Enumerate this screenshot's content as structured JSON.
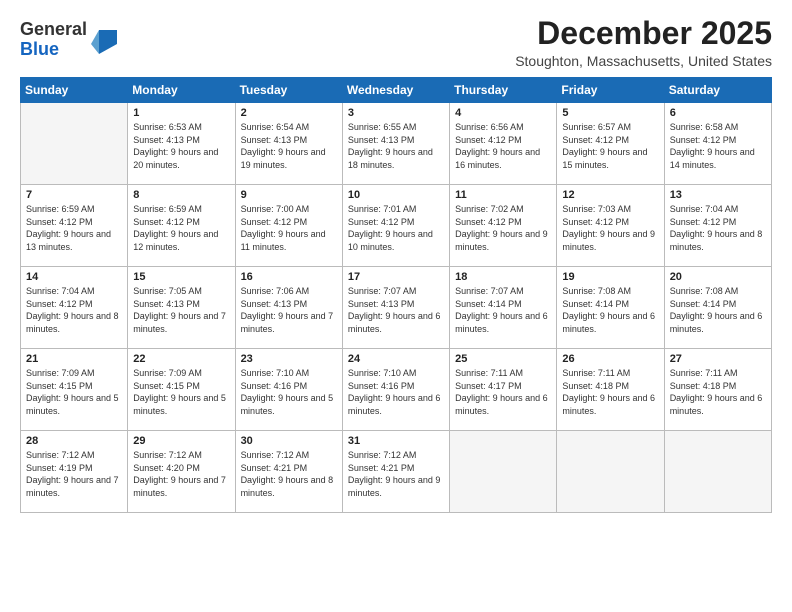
{
  "header": {
    "logo": {
      "general": "General",
      "blue": "Blue"
    },
    "month": "December 2025",
    "location": "Stoughton, Massachusetts, United States"
  },
  "weekdays": [
    "Sunday",
    "Monday",
    "Tuesday",
    "Wednesday",
    "Thursday",
    "Friday",
    "Saturday"
  ],
  "weeks": [
    [
      {
        "day": null,
        "info": null
      },
      {
        "day": "1",
        "sunrise": "6:53 AM",
        "sunset": "4:13 PM",
        "daylight": "9 hours and 20 minutes."
      },
      {
        "day": "2",
        "sunrise": "6:54 AM",
        "sunset": "4:13 PM",
        "daylight": "9 hours and 19 minutes."
      },
      {
        "day": "3",
        "sunrise": "6:55 AM",
        "sunset": "4:13 PM",
        "daylight": "9 hours and 18 minutes."
      },
      {
        "day": "4",
        "sunrise": "6:56 AM",
        "sunset": "4:12 PM",
        "daylight": "9 hours and 16 minutes."
      },
      {
        "day": "5",
        "sunrise": "6:57 AM",
        "sunset": "4:12 PM",
        "daylight": "9 hours and 15 minutes."
      },
      {
        "day": "6",
        "sunrise": "6:58 AM",
        "sunset": "4:12 PM",
        "daylight": "9 hours and 14 minutes."
      }
    ],
    [
      {
        "day": "7",
        "sunrise": "6:59 AM",
        "sunset": "4:12 PM",
        "daylight": "9 hours and 13 minutes."
      },
      {
        "day": "8",
        "sunrise": "6:59 AM",
        "sunset": "4:12 PM",
        "daylight": "9 hours and 12 minutes."
      },
      {
        "day": "9",
        "sunrise": "7:00 AM",
        "sunset": "4:12 PM",
        "daylight": "9 hours and 11 minutes."
      },
      {
        "day": "10",
        "sunrise": "7:01 AM",
        "sunset": "4:12 PM",
        "daylight": "9 hours and 10 minutes."
      },
      {
        "day": "11",
        "sunrise": "7:02 AM",
        "sunset": "4:12 PM",
        "daylight": "9 hours and 9 minutes."
      },
      {
        "day": "12",
        "sunrise": "7:03 AM",
        "sunset": "4:12 PM",
        "daylight": "9 hours and 9 minutes."
      },
      {
        "day": "13",
        "sunrise": "7:04 AM",
        "sunset": "4:12 PM",
        "daylight": "9 hours and 8 minutes."
      }
    ],
    [
      {
        "day": "14",
        "sunrise": "7:04 AM",
        "sunset": "4:12 PM",
        "daylight": "9 hours and 8 minutes."
      },
      {
        "day": "15",
        "sunrise": "7:05 AM",
        "sunset": "4:13 PM",
        "daylight": "9 hours and 7 minutes."
      },
      {
        "day": "16",
        "sunrise": "7:06 AM",
        "sunset": "4:13 PM",
        "daylight": "9 hours and 7 minutes."
      },
      {
        "day": "17",
        "sunrise": "7:07 AM",
        "sunset": "4:13 PM",
        "daylight": "9 hours and 6 minutes."
      },
      {
        "day": "18",
        "sunrise": "7:07 AM",
        "sunset": "4:14 PM",
        "daylight": "9 hours and 6 minutes."
      },
      {
        "day": "19",
        "sunrise": "7:08 AM",
        "sunset": "4:14 PM",
        "daylight": "9 hours and 6 minutes."
      },
      {
        "day": "20",
        "sunrise": "7:08 AM",
        "sunset": "4:14 PM",
        "daylight": "9 hours and 6 minutes."
      }
    ],
    [
      {
        "day": "21",
        "sunrise": "7:09 AM",
        "sunset": "4:15 PM",
        "daylight": "9 hours and 5 minutes."
      },
      {
        "day": "22",
        "sunrise": "7:09 AM",
        "sunset": "4:15 PM",
        "daylight": "9 hours and 5 minutes."
      },
      {
        "day": "23",
        "sunrise": "7:10 AM",
        "sunset": "4:16 PM",
        "daylight": "9 hours and 5 minutes."
      },
      {
        "day": "24",
        "sunrise": "7:10 AM",
        "sunset": "4:16 PM",
        "daylight": "9 hours and 6 minutes."
      },
      {
        "day": "25",
        "sunrise": "7:11 AM",
        "sunset": "4:17 PM",
        "daylight": "9 hours and 6 minutes."
      },
      {
        "day": "26",
        "sunrise": "7:11 AM",
        "sunset": "4:18 PM",
        "daylight": "9 hours and 6 minutes."
      },
      {
        "day": "27",
        "sunrise": "7:11 AM",
        "sunset": "4:18 PM",
        "daylight": "9 hours and 6 minutes."
      }
    ],
    [
      {
        "day": "28",
        "sunrise": "7:12 AM",
        "sunset": "4:19 PM",
        "daylight": "9 hours and 7 minutes."
      },
      {
        "day": "29",
        "sunrise": "7:12 AM",
        "sunset": "4:20 PM",
        "daylight": "9 hours and 7 minutes."
      },
      {
        "day": "30",
        "sunrise": "7:12 AM",
        "sunset": "4:21 PM",
        "daylight": "9 hours and 8 minutes."
      },
      {
        "day": "31",
        "sunrise": "7:12 AM",
        "sunset": "4:21 PM",
        "daylight": "9 hours and 9 minutes."
      },
      {
        "day": null,
        "info": null
      },
      {
        "day": null,
        "info": null
      },
      {
        "day": null,
        "info": null
      }
    ]
  ]
}
